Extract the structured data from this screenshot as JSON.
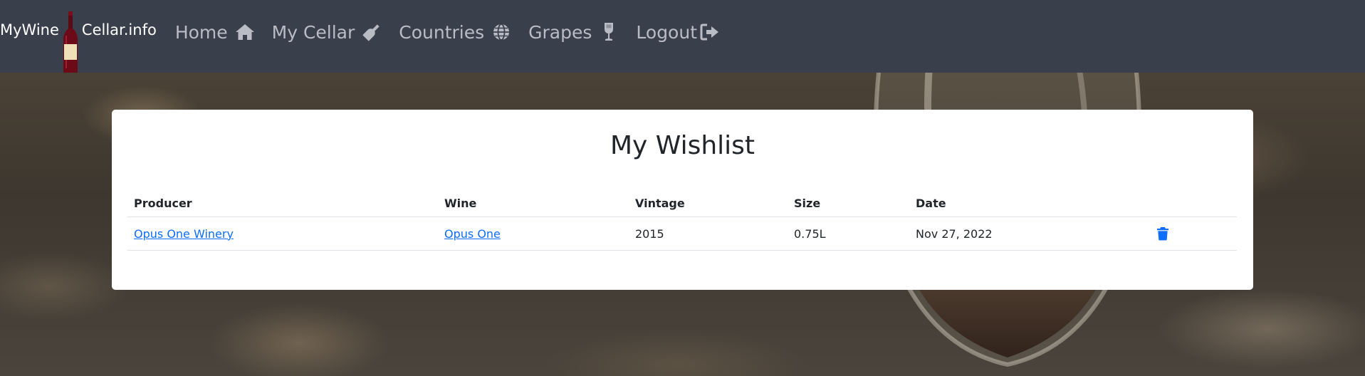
{
  "brand": {
    "part1": "MyWine",
    "part2": "Cellar.info",
    "logo_icon": "wine-bottle-icon"
  },
  "nav": {
    "items": [
      {
        "label": "Home",
        "icon": "home-icon"
      },
      {
        "label": "My Cellar",
        "icon": "wine-bottle-icon"
      },
      {
        "label": "Countries",
        "icon": "globe-icon"
      },
      {
        "label": "Grapes",
        "icon": "wine-glass-icon"
      },
      {
        "label": "Logout",
        "icon": "sign-out-icon"
      }
    ]
  },
  "wishlist": {
    "title": "My Wishlist",
    "columns": [
      "Producer",
      "Wine",
      "Vintage",
      "Size",
      "Date",
      ""
    ],
    "rows": [
      {
        "producer": "Opus One Winery",
        "wine": "Opus One",
        "vintage": "2015",
        "size": "0.75L",
        "date": "Nov 27, 2022",
        "action_icon": "trash-icon"
      }
    ]
  },
  "colors": {
    "navbar_bg": "#3a3f4c",
    "nav_text": "#b9bcc4",
    "link": "#0d6efd",
    "card_bg": "#ffffff"
  }
}
